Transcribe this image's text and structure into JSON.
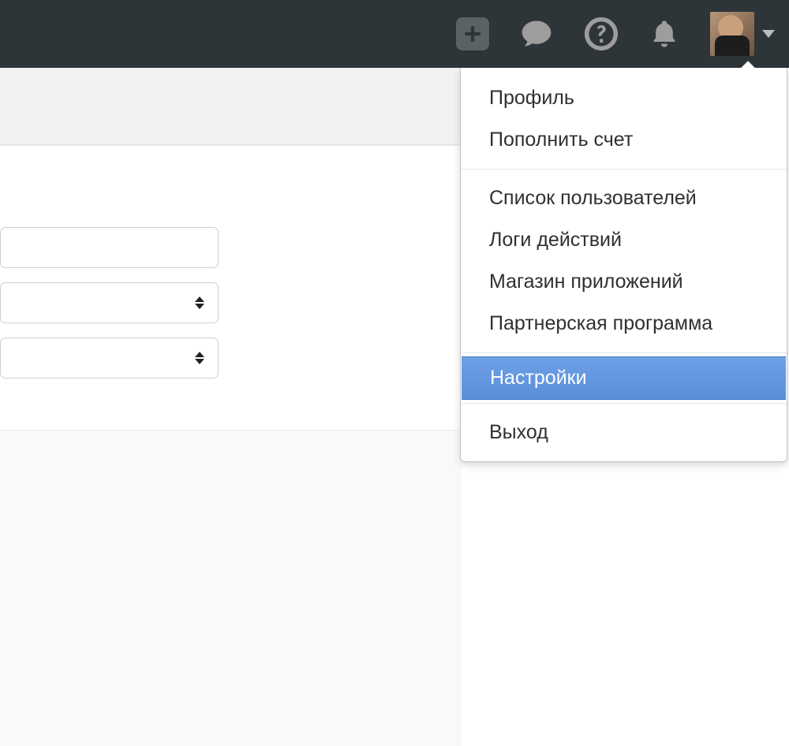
{
  "topbar": {
    "icons": {
      "plus": "plus-icon",
      "chat": "chat-icon",
      "help": "help-icon",
      "bell": "bell-icon",
      "caret": "caret-down-icon"
    }
  },
  "dropdown": {
    "group1": [
      {
        "label": "Профиль"
      },
      {
        "label": "Пополнить счет"
      }
    ],
    "group2": [
      {
        "label": "Список пользователей"
      },
      {
        "label": "Логи действий"
      },
      {
        "label": "Магазин приложений"
      },
      {
        "label": "Партнерская программа"
      }
    ],
    "settings": {
      "label": "Настройки"
    },
    "exit": {
      "label": "Выход"
    }
  },
  "form": {
    "text_value": "",
    "select1_value": "",
    "select2_value": ""
  },
  "colors": {
    "topbar_bg": "#2e3538",
    "dropdown_highlight": "#5a8fd9"
  }
}
